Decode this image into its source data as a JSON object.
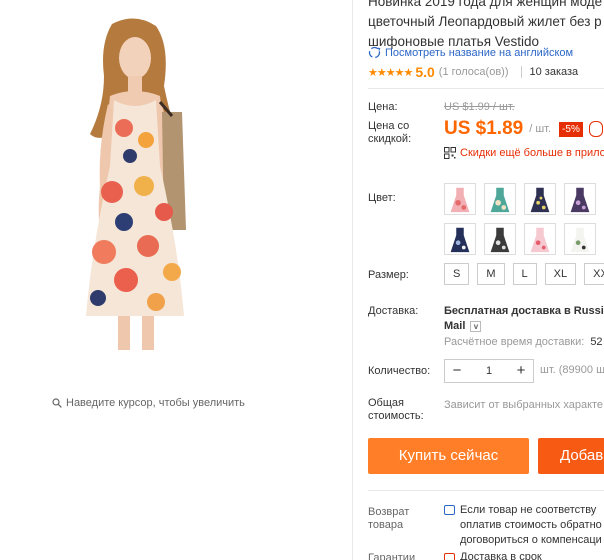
{
  "gallery": {
    "zoom_hint": "Наведите курсор, чтобы увеличить"
  },
  "product": {
    "title_line1": "Новинка 2019 года для женщин моде",
    "title_line2": "цветочный Леопардовый жилет без р",
    "title_line3": "шифоновые платья Vestido",
    "translate_link": "Посмотреть название на английском",
    "rating_value": "5.0",
    "votes": "(1 голоса(ов))",
    "orders": "10 заказа"
  },
  "price": {
    "label": "Цена:",
    "old": "US $1.99 / шт.",
    "discount_label": "Цена со скидкой:",
    "current": "US $1.89",
    "unit": "/ шт.",
    "discount": "-5%",
    "qr_text": "Скидки ещё больше в прило"
  },
  "options": {
    "color_label": "Цвет:",
    "size_label": "Размер:",
    "sizes": [
      "S",
      "M",
      "L",
      "XL",
      "XXL"
    ]
  },
  "shipping": {
    "label": "Доставка:",
    "title": "Бесплатная доставка в Russian",
    "carrier": "Mail",
    "time_label": "Расчётное время доставки:",
    "time_value": "52"
  },
  "quantity": {
    "label": "Количество:",
    "value": "1",
    "minus": "−",
    "plus": "+",
    "unit": "шт. (89900 ш"
  },
  "total": {
    "label": "Общая стоимость:",
    "note": "Зависит от выбранных характе"
  },
  "buttons": {
    "buy": "Купить сейчас",
    "add": "Добав"
  },
  "returns": {
    "label": "Возврат товара",
    "line1": "Если товар не соответству",
    "line2": "оплатив стоимость обратно",
    "line3": "договориться о компенсаци"
  },
  "guarantee": {
    "label": "Гарантии",
    "text": "Доставка в срок"
  },
  "colors": {
    "accent": "#ff6600",
    "buy": "#ff7e27",
    "add": "#f65a13",
    "discount": "#e62e04",
    "link": "#2c67c6"
  }
}
